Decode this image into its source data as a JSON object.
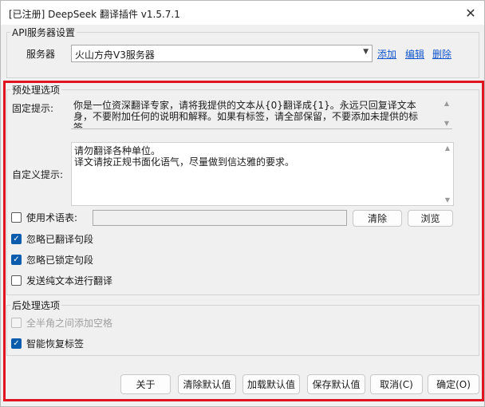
{
  "window": {
    "title": "[已注册] DeepSeek 翻译插件 v1.5.7.1",
    "close_glyph": "✕"
  },
  "api_group": {
    "title": "API服务器设置",
    "server_label": "服务器",
    "server_value": "火山方舟V3服务器",
    "links": {
      "add": "添加",
      "edit": "编辑",
      "delete": "删除"
    }
  },
  "preprocess": {
    "title": "预处理选项",
    "fixed_prompt_label": "固定提示:",
    "fixed_prompt_text": "你是一位资深翻译专家，请将我提供的文本从{0}翻译成{1}。永远只回复译文本身，不要附加任何的说明和解释。如果有标签，请全部保留，不要添加未提供的标签。",
    "custom_prompt_label": "自定义提示:",
    "custom_prompt_text": "请勿翻译各种单位。\n译文请按正规书面化语气，尽量做到信达雅的要求。",
    "glossary": {
      "label": "使用术语表:",
      "checked": false,
      "clear_label": "清除",
      "browse_label": "浏览"
    },
    "ignore_translated": {
      "label": "忽略已翻译句段",
      "checked": true
    },
    "ignore_locked": {
      "label": "忽略已锁定句段",
      "checked": true
    },
    "send_plain": {
      "label": "发送纯文本进行翻译",
      "checked": false
    }
  },
  "postprocess": {
    "title": "后处理选项",
    "add_space": {
      "label": "全半角之间添加空格",
      "checked": false,
      "disabled": true
    },
    "restore_tags": {
      "label": "智能恢复标签",
      "checked": true
    }
  },
  "footer": {
    "about": "关于",
    "clear_default": "清除默认值",
    "load_default": "加载默认值",
    "save_default": "保存默认值",
    "cancel": "取消(C)",
    "ok": "确定(O)"
  },
  "colors": {
    "highlight": "#e0141e",
    "checkbox_accent": "#0b5cad",
    "link": "#1155cc"
  }
}
